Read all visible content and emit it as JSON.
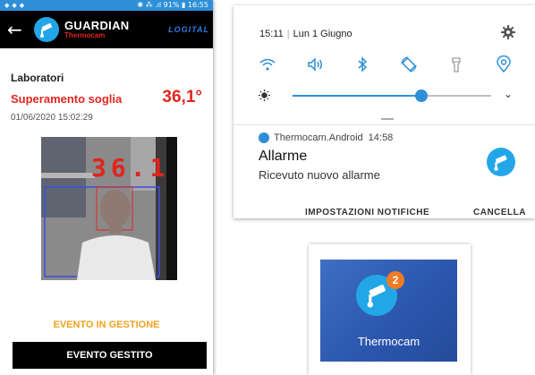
{
  "phone": {
    "statusbar": {
      "right_text": "✱ ⁂ .ıl 91% ▮ 16:55"
    },
    "appbar": {
      "back_icon": "arrow-back-icon",
      "brand_title": "GUARDIAN",
      "brand_subtitle": "Thermocam",
      "partner_logo": "LOGITAL"
    },
    "section_title": "Laboratori",
    "alarm": {
      "title": "Superamento soglia",
      "temperature": "36,1°",
      "timestamp": "01/06/2020 15:02:29",
      "overlay_temperature": "36.1"
    },
    "event_status": "EVENTO IN GESTIONE",
    "event_button": "EVENTO GESTITO"
  },
  "quick_settings": {
    "time": "15:11",
    "date": "Lun 1 Giugno",
    "icons": [
      "wifi-icon",
      "volume-icon",
      "bluetooth-icon",
      "auto-rotate-icon",
      "flashlight-icon",
      "location-icon"
    ],
    "brightness_level": 0.65
  },
  "notification": {
    "app_name": "Thermocam.Android",
    "time": "14:58",
    "title": "Allarme",
    "text": "Ricevuto nuovo allarme",
    "actions": [
      "IMPOSTAZIONI NOTIFICHE",
      "CANCELLA"
    ]
  },
  "app_tile": {
    "label": "Thermocam",
    "badge": "2"
  },
  "colors": {
    "accent_blue": "#2e8fd8",
    "alarm_red": "#e2261e",
    "warning_orange": "#f0a21c",
    "badge_orange": "#f07b24"
  }
}
